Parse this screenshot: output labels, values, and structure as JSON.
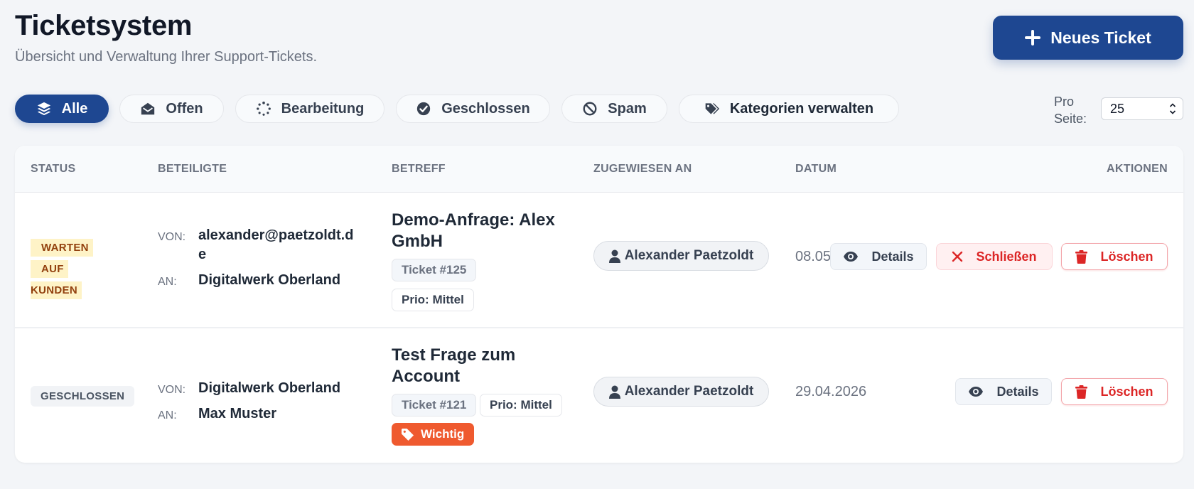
{
  "header": {
    "title": "Ticketsystem",
    "subtitle": "Übersicht und Verwaltung Ihrer Support-Tickets.",
    "new_button": "Neues Ticket"
  },
  "filters": [
    {
      "label": "Alle",
      "icon": "layers-icon",
      "active": true
    },
    {
      "label": "Offen",
      "icon": "envelope-open-icon"
    },
    {
      "label": "Bearbeitung",
      "icon": "spinner-icon"
    },
    {
      "label": "Geschlossen",
      "icon": "check-circle-icon"
    },
    {
      "label": "Spam",
      "icon": "ban-icon"
    },
    {
      "label": "Kategorien verwalten",
      "icon": "tags-icon"
    }
  ],
  "per_page": {
    "label": "Pro Seite:",
    "value": "25"
  },
  "table": {
    "columns": [
      "STATUS",
      "BETEILIGTE",
      "BETREFF",
      "ZUGEWIESEN AN",
      "DATUM",
      "AKTIONEN"
    ],
    "from_label": "VON:",
    "to_label": "AN:",
    "rows": [
      {
        "status": [
          "WARTEN AUF",
          "KUNDEN"
        ],
        "from": [
          "alexander@paetzoldt.d",
          "e"
        ],
        "to": "Digitalwerk Oberland",
        "subject": [
          "Demo-Anfrage: Alex",
          "GmbH"
        ],
        "ticket": "Ticket #125",
        "prio": "Prio: Mittel",
        "assignee": "Alexander Paetzoldt",
        "date": "08.05",
        "actions": {
          "details": "Details",
          "close": "Schließen",
          "delete": "Löschen"
        }
      },
      {
        "status": "GESCHLOSSEN",
        "from": "Digitalwerk Oberland",
        "to": "Max Muster",
        "subject": [
          "Test Frage zum",
          "Account"
        ],
        "ticket": "Ticket #121",
        "prio": "Prio: Mittel",
        "tag": "Wichtig",
        "assignee": "Alexander Paetzoldt",
        "date": "29.04.2026",
        "actions": {
          "details": "Details",
          "delete": "Löschen"
        }
      }
    ]
  },
  "colors": {
    "primary": "#1e4791",
    "danger": "#dc2626",
    "warning_bg": "#fef3c7",
    "tag": "#ef5a2f"
  }
}
